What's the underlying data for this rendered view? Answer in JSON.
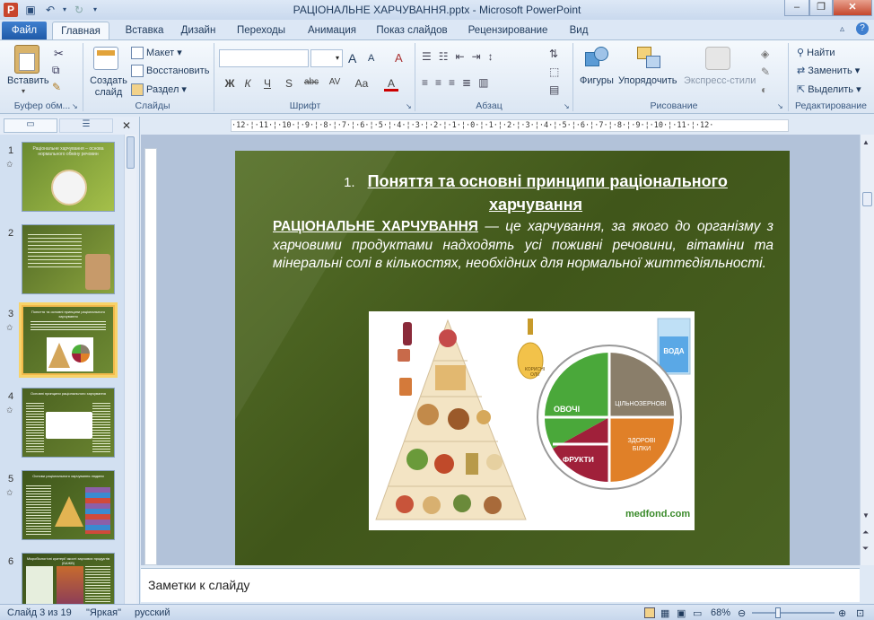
{
  "window": {
    "title": "РАЦІОНАЛЬНЕ ХАРЧУВАННЯ.pptx - Microsoft PowerPoint"
  },
  "tabs": [
    "Файл",
    "Главная",
    "Вставка",
    "Дизайн",
    "Переходы",
    "Анимация",
    "Показ слайдов",
    "Рецензирование",
    "Вид"
  ],
  "ribbon": {
    "clipboard": {
      "paste": "Вставить",
      "label": "Буфер обм..."
    },
    "slides": {
      "create": "Создать слайд",
      "layout": "Макет",
      "reset": "Восстановить",
      "section": "Раздел",
      "label": "Слайды"
    },
    "font": {
      "label": "Шрифт",
      "bold": "Ж",
      "italic": "К",
      "underline": "Ч",
      "shadow": "S",
      "strike": "abc",
      "spacing": "AV",
      "case": "Aa",
      "grow": "A",
      "shrink": "A",
      "clear": "A",
      "color": "A"
    },
    "paragraph": {
      "label": "Абзац"
    },
    "drawing": {
      "shapes": "Фигуры",
      "arrange": "Упорядочить",
      "styles": "Экспресс-стили",
      "label": "Рисование"
    },
    "editing": {
      "find": "Найти",
      "replace": "Заменить",
      "select": "Выделить",
      "label": "Редактирование"
    }
  },
  "ruler": "·12·¦·11·¦·10·¦·9·¦·8·¦·7·¦·6·¦·5·¦·4·¦·3·¦·2·¦·1·¦·0·¦·1·¦·2·¦·3·¦·4·¦·5·¦·6·¦·7·¦·8·¦·9·¦·10·¦·11·¦·12·",
  "thumbnails": [
    {
      "num": "1",
      "title": "Раціональне харчування – основа нормального обміну речовин"
    },
    {
      "num": "2"
    },
    {
      "num": "3",
      "selected": true,
      "title": "Поняття та основні принципи раціонального харчування"
    },
    {
      "num": "4",
      "title": "Основні принципи раціонального харчування"
    },
    {
      "num": "5",
      "title": "Основи раціонального харчування людини"
    },
    {
      "num": "6",
      "title": "Мікробіологічні критерії якості харчових продуктів (БАЖВ)"
    }
  ],
  "slide": {
    "list_num": "1.",
    "heading": "Поняття та основні принципи раціонального харчування",
    "term": "РАЦІОНАЛЬНЕ ХАРЧУВАННЯ",
    "definition": " — це харчування, за якого до організму з харчовими продуктами надходять усі поживні речовини, вітаміни та мінеральні солі в кількостях, необхідних для нормальної життєдіяльності.",
    "image": {
      "oil": "КОРИСНІ ОЛІЇ",
      "water": "ВОДА",
      "vegetables": "ОВОЧІ",
      "grains": "ЦІЛЬНОЗЕРНОВІ",
      "fruits": "ФРУКТИ",
      "protein": "ЗДОРОВІ БІЛКИ",
      "site": "medfond.com"
    }
  },
  "notes": {
    "placeholder": "Заметки к слайду"
  },
  "status": {
    "slide": "Слайд 3 из 19",
    "theme": "\"Яркая\"",
    "lang": "русский",
    "zoom": "68%"
  }
}
